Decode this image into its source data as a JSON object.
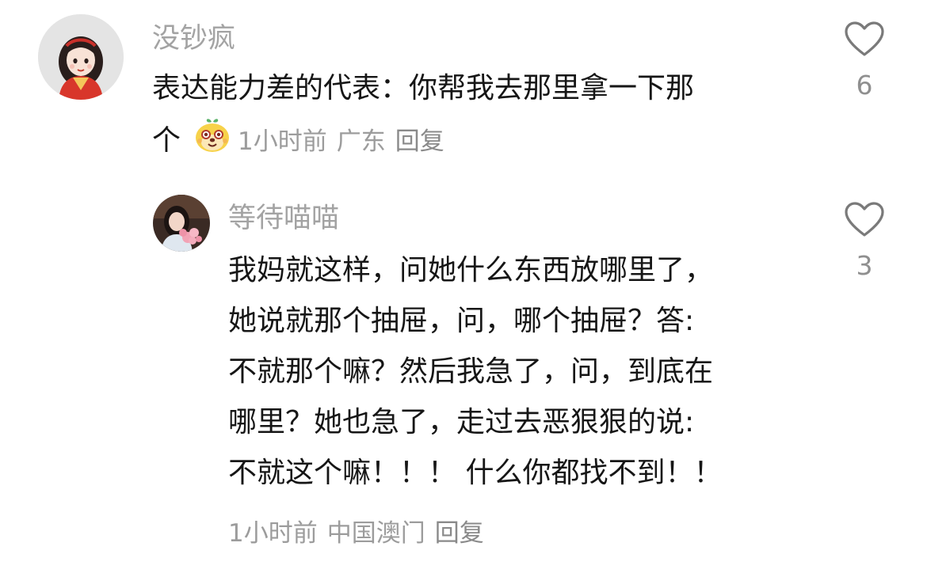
{
  "comments": [
    {
      "username": "没钞疯",
      "text_lines": [
        "表达能力差的代表：你帮我去那里拿一下那",
        "个"
      ],
      "emoji": "dog-face-emoji",
      "time": "1小时前",
      "location": "广东",
      "reply_label": "回复",
      "like_count": "6"
    },
    {
      "username": "等待喵喵",
      "text_lines": [
        "我妈就这样，问她什么东西放哪里了，",
        "她说就那个抽屉，问，哪个抽屉？答:",
        "不就那个嘛？然后我急了，问，到底在",
        "哪里？她也急了，走过去恶狠狠的说:",
        "不就这个嘛！！！ 什么你都找不到！！"
      ],
      "time": "1小时前",
      "location": "中国澳门",
      "reply_label": "回复",
      "like_count": "3"
    }
  ],
  "colors": {
    "text": "#161616",
    "username": "#a3a3a3",
    "meta": "#9c9c9c",
    "icon": "#7a7a7a"
  }
}
